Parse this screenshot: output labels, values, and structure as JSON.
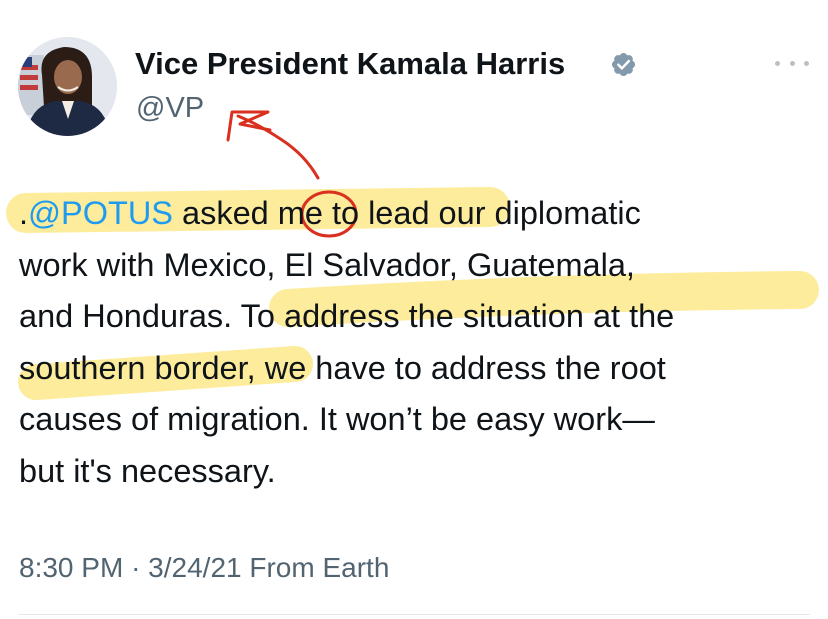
{
  "author": {
    "name": "Vice President Kamala Harris",
    "handle": "@VP",
    "verified": true
  },
  "tweet": {
    "lines": [
      [
        {
          "text": ".",
          "type": "text"
        },
        {
          "text": "@POTUS",
          "type": "mention"
        },
        {
          "text": " asked me to lead our diplomatic",
          "type": "text"
        }
      ],
      [
        {
          "text": "work with Mexico, El Salvador, Guatemala,",
          "type": "text"
        }
      ],
      [
        {
          "text": "and Honduras. To address the situation at the",
          "type": "text"
        }
      ],
      [
        {
          "text": "southern border, we have to address the root",
          "type": "text"
        }
      ],
      [
        {
          "text": "causes of migration. It won’t be easy work—",
          "type": "text"
        }
      ],
      [
        {
          "text": "but it's necessary.",
          "type": "text"
        }
      ]
    ]
  },
  "meta": {
    "time": "8:30 PM",
    "separator": "·",
    "date": "3/24/21",
    "source": "From Earth"
  },
  "colors": {
    "link": "#1d9bf0",
    "secondary_text": "#536471",
    "highlight": "#fde98a",
    "annotation": "#d9301f",
    "verified_badge": "#829aab"
  },
  "icons": {
    "verified": "verified-badge-icon",
    "more": "more-options-icon"
  }
}
